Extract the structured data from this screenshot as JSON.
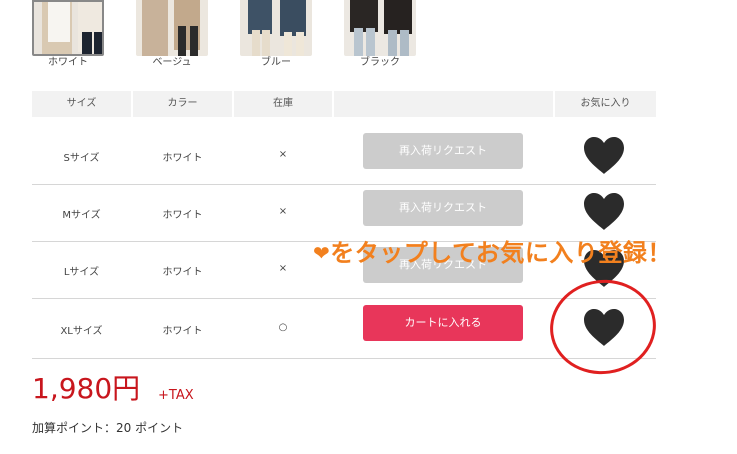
{
  "swatches": [
    {
      "label": "ホワイト"
    },
    {
      "label": "ベージュ"
    },
    {
      "label": "ブルー"
    },
    {
      "label": "ブラック"
    }
  ],
  "table": {
    "headers": [
      "サイズ",
      "カラー",
      "在庫",
      "",
      "お気に入り"
    ],
    "rows": [
      {
        "size": "Sサイズ",
        "color": "ホワイト",
        "stock": "×",
        "button": "再入荷リクエスト",
        "button_state": "disabled"
      },
      {
        "size": "Mサイズ",
        "color": "ホワイト",
        "stock": "×",
        "button": "再入荷リクエスト",
        "button_state": "disabled"
      },
      {
        "size": "Lサイズ",
        "color": "ホワイト",
        "stock": "×",
        "button": "再入荷リクエスト",
        "button_state": "disabled"
      },
      {
        "size": "XLサイズ",
        "color": "ホワイト",
        "stock": "○",
        "button": "カートに入れる",
        "button_state": "enabled"
      }
    ]
  },
  "annotation": {
    "heart_symbol": "❤",
    "text": "をタップしてお気に入り登録！"
  },
  "price": {
    "amount": "1,980円",
    "tax_label": "+TAX",
    "points": "加算ポイント：20 ポイント"
  },
  "colors": {
    "cart_button": "#e8365a",
    "disabled_button": "#cccccc",
    "price": "#c8161d",
    "annotation": "#f2801e",
    "ring": "#e02020",
    "heart": "#2b2b2b"
  },
  "icons": {
    "favorite": "heart-icon"
  }
}
